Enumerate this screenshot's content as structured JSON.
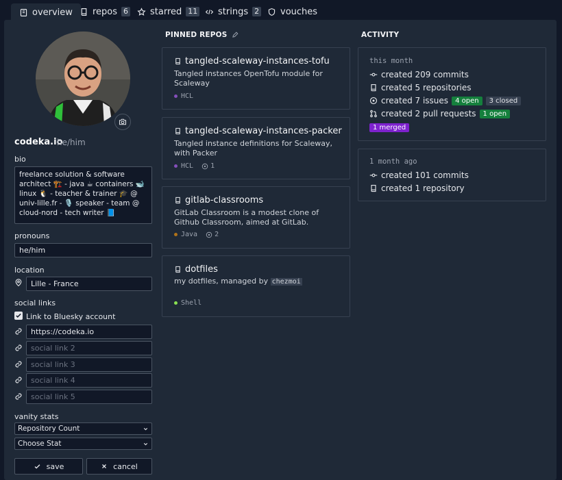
{
  "tabs": [
    {
      "label": "overview",
      "icon": "book-icon"
    },
    {
      "label": "repos",
      "count": "6",
      "icon": "repo-icon"
    },
    {
      "label": "starred",
      "count": "11",
      "icon": "star-icon"
    },
    {
      "label": "strings",
      "count": "2",
      "icon": "code-icon"
    },
    {
      "label": "vouches",
      "icon": "shield-icon"
    }
  ],
  "profile": {
    "handle": "codeka.io",
    "pronouns_display": "he/him",
    "bio_label": "bio",
    "bio_text": "freelance solution & software architect 🏗️ - java ☕ containers 🐋 linux 🐧 - teacher & trainer 🎓 @ univ-lille.fr - 🎙️ speaker - team @ cloud-nord - tech writer 📘",
    "pronouns_label": "pronouns",
    "pronouns_value": "he/him",
    "location_label": "location",
    "location_value": "Lille - France",
    "social_label": "social links",
    "bluesky_label": "Link to Bluesky account",
    "links": [
      {
        "value": "https://codeka.io",
        "placeholder": ""
      },
      {
        "value": "",
        "placeholder": "social link 2"
      },
      {
        "value": "",
        "placeholder": "social link 3"
      },
      {
        "value": "",
        "placeholder": "social link 4"
      },
      {
        "value": "",
        "placeholder": "social link 5"
      }
    ],
    "vanity_label": "vanity stats",
    "vanity_options": [
      "Repository Count",
      "Choose Stat"
    ],
    "save_label": "save",
    "cancel_label": "cancel"
  },
  "pinned": {
    "heading": "PINNED REPOS",
    "repos": [
      {
        "name": "tangled-scaleway-instances-tofu",
        "desc": "Tangled instances OpenTofu module for Scaleway",
        "lang": "HCL",
        "lang_color": "#844fba",
        "issues": ""
      },
      {
        "name": "tangled-scaleway-instances-packer",
        "desc": "Tangled instance definitions for Scaleway, with Packer",
        "lang": "HCL",
        "lang_color": "#844fba",
        "issues": "1"
      },
      {
        "name": "gitlab-classrooms",
        "desc": "GitLab Classroom is a modest clone of Github Classroom, aimed at GitLab.",
        "lang": "Java",
        "lang_color": "#b07219",
        "issues": "2"
      },
      {
        "name": "dotfiles",
        "desc_prefix": "my dotfiles, managed by ",
        "desc_code": "chezmoi",
        "lang": "Shell",
        "lang_color": "#89e051",
        "issues": ""
      }
    ]
  },
  "activity": {
    "heading": "ACTIVITY",
    "groups": [
      {
        "period": "this month",
        "commits": "created 209 commits",
        "repos": "created 5 repositories",
        "issues": "created 7 issues",
        "issues_open": "4 open",
        "issues_closed": "3 closed",
        "prs": "created 2 pull requests",
        "prs_open": "1 open",
        "prs_merged": "1 merged"
      },
      {
        "period": "1 month ago",
        "commits": "created 101 commits",
        "repos": "created 1 repository"
      }
    ]
  }
}
